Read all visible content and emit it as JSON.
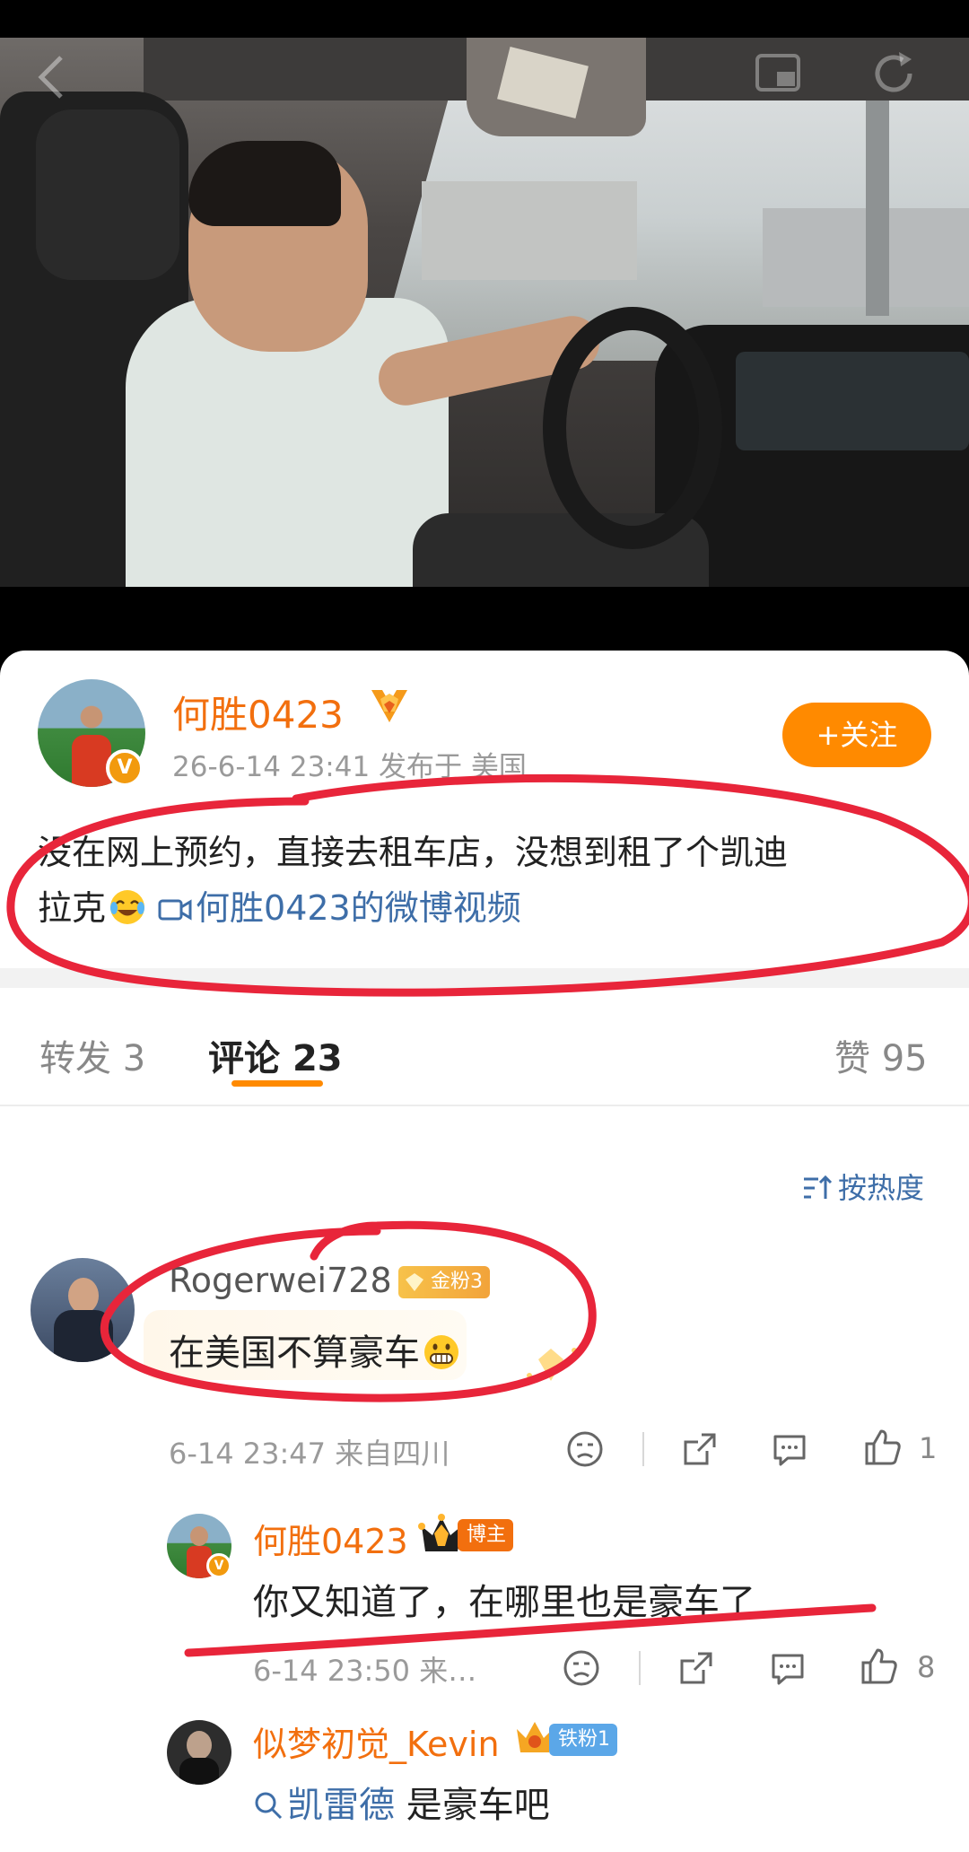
{
  "video": {
    "back_icon": "chevron-left-icon",
    "pip_icon": "picture-in-picture-icon",
    "more_icon": "refresh-icon"
  },
  "post": {
    "author": "何胜0423",
    "rank_icon": "orange-medal-icon",
    "verified_badge": "V",
    "meta": "26-6-14 23:41  发布于 美国",
    "follow_label": "+关注",
    "text_line1": "没在网上预约，直接去租车店，没想到租了个凯迪",
    "text_line2": "拉克",
    "video_link": "何胜0423的微博视频"
  },
  "tabs": {
    "repost_label": "转发",
    "repost_count": "3",
    "comments_label": "评论",
    "comments_count": "23",
    "likes_label": "赞",
    "likes_count": "95"
  },
  "sort": {
    "label": "按热度"
  },
  "comments": [
    {
      "user": "Rogerwei728",
      "badge": "金粉3",
      "text": "在美国不算豪车",
      "meta": "6-14 23:47  来自四川",
      "like_count": "1",
      "replies": [
        {
          "user": "何胜0423",
          "badge": "博主",
          "text": "你又知道了，在哪里也是豪车了",
          "meta": "6-14 23:50  来…",
          "like_count": "8"
        },
        {
          "user": "似梦初觉_Kevin",
          "badge": "铁粉1",
          "text_link": "凯雷德",
          "text_rest": " 是豪车吧"
        }
      ]
    }
  ],
  "colors": {
    "accent": "#ff8a00",
    "username": "#f26f0e",
    "link": "#3e6ea8",
    "annotation": "#e8253a"
  }
}
